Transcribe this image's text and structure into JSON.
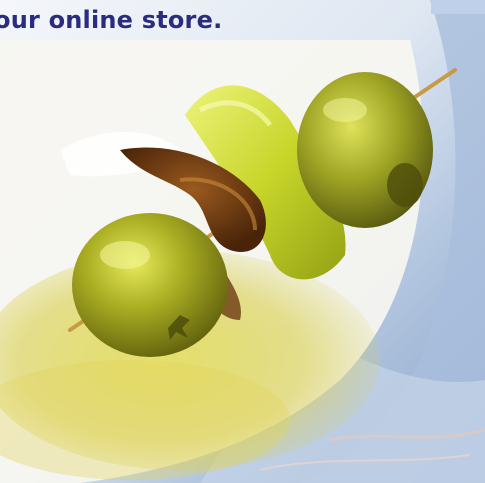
{
  "headline": "our online store.",
  "colors": {
    "headline": "#2b2c7f",
    "background_blue": "#c9d7ea",
    "olive_green": "#8fa31c",
    "pepper_yellow": "#c9d629",
    "anchovy_brown": "#6b3a12"
  },
  "image": {
    "subject": "olive, anchovy and pepper skewer",
    "icon": "skewer-photo"
  }
}
